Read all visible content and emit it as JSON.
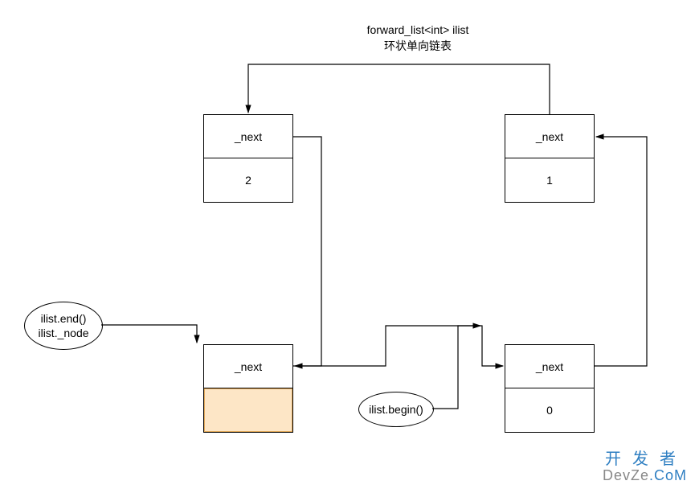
{
  "title": {
    "line1": "forward_list<int> ilist",
    "line2": "环状单向链表"
  },
  "chart_data": {
    "type": "graph",
    "title": "forward_list<int> ilist 环状单向链表",
    "nodes": [
      {
        "id": "head",
        "field": "_next",
        "value": null,
        "annotations": [
          "ilist.end()",
          "ilist._node"
        ]
      },
      {
        "id": "n0",
        "field": "_next",
        "value": 0,
        "annotations": [
          "ilist.begin()"
        ]
      },
      {
        "id": "n1",
        "field": "_next",
        "value": 1
      },
      {
        "id": "n2",
        "field": "_next",
        "value": 2
      }
    ],
    "edges": [
      {
        "from": "head",
        "to": "n0"
      },
      {
        "from": "n0",
        "to": "n1"
      },
      {
        "from": "n1",
        "to": "n2"
      },
      {
        "from": "n2",
        "to": "head"
      },
      {
        "from": "oval_end",
        "to": "head"
      },
      {
        "from": "oval_begin",
        "to": "n0"
      }
    ]
  },
  "nodes": {
    "n2": {
      "next_label": "_next",
      "value": "2"
    },
    "n1": {
      "next_label": "_next",
      "value": "1"
    },
    "head": {
      "next_label": "_next"
    },
    "n0": {
      "next_label": "_next",
      "value": "0"
    }
  },
  "ovals": {
    "end": {
      "line1": "ilist.end()",
      "line2": "ilist._node"
    },
    "begin": {
      "label": "ilist.begin()"
    }
  },
  "watermark": {
    "cn": "开发者",
    "en_plain": "DevZe",
    "en_alt": ".CoM"
  }
}
